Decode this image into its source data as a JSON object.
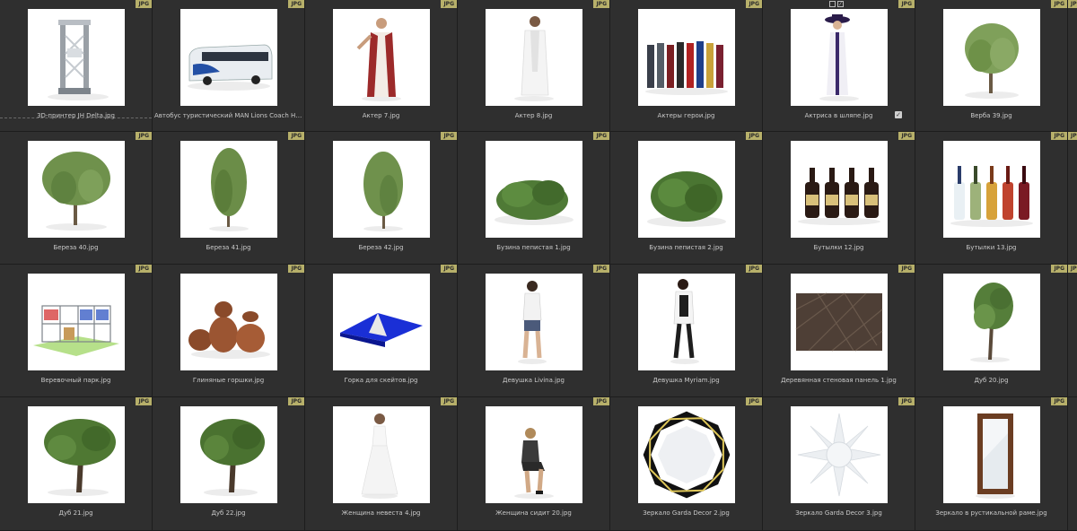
{
  "badge": "JPG",
  "items": [
    {
      "label": "3D-принтер JH Delta.jpg",
      "icon": "printer-frame-icon"
    },
    {
      "label": "Автобус туристический MAN Lions Coach HTA.jpg",
      "icon": "bus-icon"
    },
    {
      "label": "Актер 7.jpg",
      "icon": "actor-robe-icon"
    },
    {
      "label": "Актер 8.jpg",
      "icon": "actor-white-icon"
    },
    {
      "label": "Актеры герои.jpg",
      "icon": "heroes-group-icon"
    },
    {
      "label": "Актриса в шляпе.jpg",
      "icon": "actress-hat-icon"
    },
    {
      "label": "Верба 39.jpg",
      "icon": "willow-tree-icon"
    },
    {
      "label": "Береза 40.jpg",
      "icon": "birch-tree-icon"
    },
    {
      "label": "Береза 41.jpg",
      "icon": "birch-tree-icon"
    },
    {
      "label": "Береза 42.jpg",
      "icon": "birch-tree-icon"
    },
    {
      "label": "Бузина пепистая 1.jpg",
      "icon": "shrub-icon"
    },
    {
      "label": "Бузина пепистая 2.jpg",
      "icon": "shrub-icon"
    },
    {
      "label": "Бутылки 12.jpg",
      "icon": "bottles-dark-icon"
    },
    {
      "label": "Бутылки 13.jpg",
      "icon": "bottles-color-icon"
    },
    {
      "label": "Веревочный парк.jpg",
      "icon": "rope-park-icon"
    },
    {
      "label": "Глиняные горшки.jpg",
      "icon": "clay-pots-icon"
    },
    {
      "label": "Горка для скейтов.jpg",
      "icon": "skate-ramp-icon"
    },
    {
      "label": "Девушка Livina.jpg",
      "icon": "girl-standing-icon"
    },
    {
      "label": "Девушка Myriam.jpg",
      "icon": "girl-walking-icon"
    },
    {
      "label": "Деревянная стеновая панель 1.jpg",
      "icon": "wood-panel-icon"
    },
    {
      "label": "Дуб 20.jpg",
      "icon": "oak-tree-icon"
    },
    {
      "label": "Дуб 21.jpg",
      "icon": "oak-tree-icon"
    },
    {
      "label": "Дуб 22.jpg",
      "icon": "oak-tree-icon"
    },
    {
      "label": "Женщина невеста 4.jpg",
      "icon": "bride-icon"
    },
    {
      "label": "Женщина сидит 20.jpg",
      "icon": "woman-sitting-icon"
    },
    {
      "label": "Зеркало Garda Decor 2.jpg",
      "icon": "mirror-octagon-icon"
    },
    {
      "label": "Зеркало Garda Decor 3.jpg",
      "icon": "mirror-sunburst-icon"
    },
    {
      "label": "Зеркало в рустикальной раме.jpg",
      "icon": "mirror-rustic-icon"
    }
  ]
}
